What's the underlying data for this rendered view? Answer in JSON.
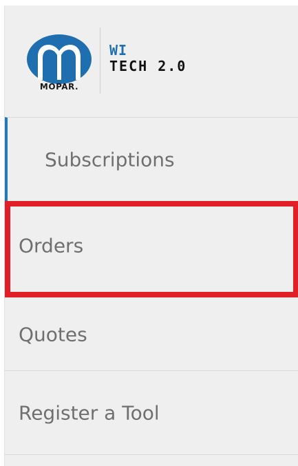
{
  "brand": {
    "logo_icon": "mopar-m-icon",
    "logo_text": "MOPAR.",
    "product_line1": "WI",
    "product_line2": "TECH 2.0"
  },
  "nav": {
    "items": [
      {
        "label": "Subscriptions",
        "state": "active"
      },
      {
        "label": "Orders",
        "state": "highlighted"
      },
      {
        "label": "Quotes",
        "state": "normal"
      },
      {
        "label": "Register a Tool",
        "state": "normal"
      }
    ]
  },
  "colors": {
    "active_indicator": "#1f79c1",
    "highlight_border": "#e01f26",
    "logo_blue": "#1f6fb0",
    "text": "#6f6f6f",
    "background": "#efefef"
  }
}
